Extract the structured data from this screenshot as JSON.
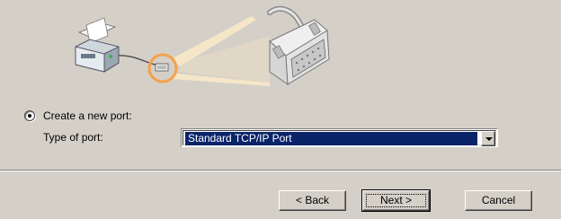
{
  "port": {
    "create_label": "Create a new port:",
    "type_label": "Type of port:",
    "selected_type": "Standard TCP/IP Port",
    "create_selected": true
  },
  "buttons": {
    "back": "< Back",
    "next": "Next >",
    "cancel": "Cancel"
  },
  "icons": {
    "printer": "printer-icon",
    "port_connector": "port-connector-icon",
    "cable_plug": "db25-cable-plug-icon"
  },
  "colors": {
    "dialog_bg": "#d4d0c8",
    "selection": "#0a246a",
    "highlight_ring": "#f5a14a"
  }
}
